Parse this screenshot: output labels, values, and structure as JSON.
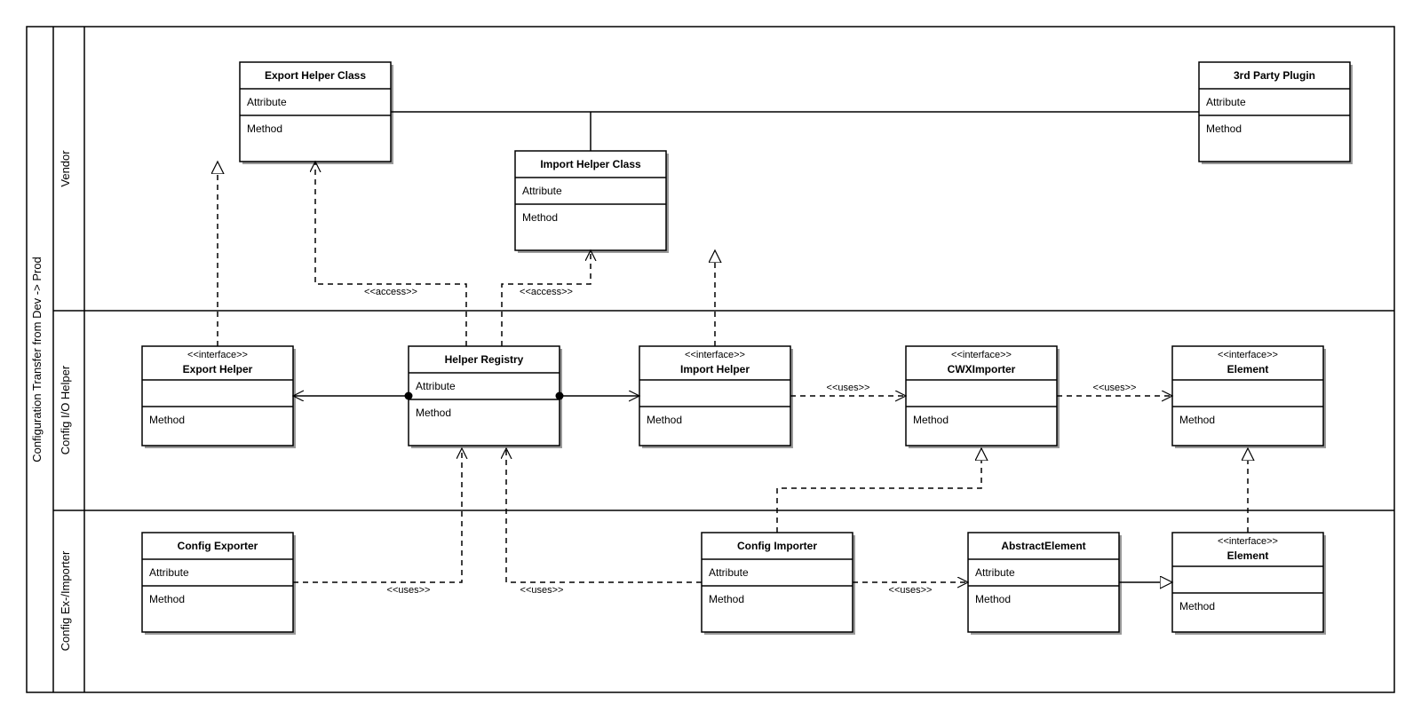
{
  "diagram": {
    "title": "Configuration Transfer from Dev -> Prod",
    "partitions": {
      "vendor": "Vendor",
      "helper": "Config I/O Helper",
      "importer": "Config Ex-/Importer"
    },
    "classes": {
      "exportHelperClass": {
        "name": "Export Helper Class",
        "attr": "Attribute",
        "method": "Method"
      },
      "thirdPartyPlugin": {
        "name": "3rd Party Plugin",
        "attr": "Attribute",
        "method": "Method"
      },
      "importHelperClass": {
        "name": "Import Helper Class",
        "attr": "Attribute",
        "method": "Method"
      },
      "exportHelper": {
        "stereotype": "<<interface>>",
        "name": "Export Helper",
        "method": "Method"
      },
      "helperRegistry": {
        "name": "Helper Registry",
        "attr": "Attribute",
        "method": "Method"
      },
      "importHelper": {
        "stereotype": "<<interface>>",
        "name": "Import Helper",
        "method": "Method"
      },
      "cwxImporter": {
        "stereotype": "<<interface>>",
        "name": "CWXImporter",
        "method": "Method"
      },
      "element1": {
        "stereotype": "<<interface>>",
        "name": "Element",
        "method": "Method"
      },
      "configExporter": {
        "name": "Config Exporter",
        "attr": "Attribute",
        "method": "Method"
      },
      "configImporter": {
        "name": "Config Importer",
        "attr": "Attribute",
        "method": "Method"
      },
      "abstractElement": {
        "name": "AbstractElement",
        "attr": "Attribute",
        "method": "Method"
      },
      "element2": {
        "stereotype": "<<interface>>",
        "name": "Element",
        "method": "Method"
      }
    },
    "labels": {
      "access1": "<<access>>",
      "access2": "<<access>>",
      "uses1": "<<uses>>",
      "uses2": "<<uses>>",
      "uses3": "<<uses>>",
      "uses4": "<<uses>>",
      "uses5": "<<uses>>"
    }
  }
}
